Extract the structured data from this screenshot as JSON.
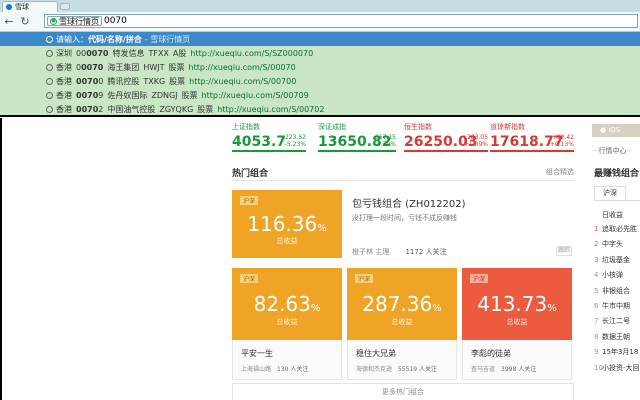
{
  "browser": {
    "tab_title": "雪球",
    "search_engine": "雪球行情页",
    "query": "0070",
    "colors": {
      "selected_row": "#3c88c9",
      "dropdown_bg": "#c9e7c4",
      "url_green": "#0a6b2b"
    }
  },
  "suggestions": {
    "hint_row": {
      "prefix": "请输入：",
      "main": "代码/名称/拼合",
      "hint": "- 雪球行情页"
    },
    "rows": [
      {
        "market": "深圳",
        "code_pre": "00",
        "code_hl": "0070",
        "code_post": "",
        "name": "特发信息",
        "abbr": "TFXX",
        "type": "A股",
        "url": "http://xueqiu.com/S/SZ000070"
      },
      {
        "market": "香港",
        "code_pre": "0",
        "code_hl": "0070",
        "code_post": "",
        "name": "海王集团",
        "abbr": "HWJT",
        "type": "股票",
        "url": "http://xueqiu.com/S/00070"
      },
      {
        "market": "香港",
        "code_pre": "",
        "code_hl": "0070",
        "code_post": "0",
        "name": "腾讯控股",
        "abbr": "TXKG",
        "type": "股票",
        "url": "http://xueqiu.com/S/00700"
      },
      {
        "market": "香港",
        "code_pre": "",
        "code_hl": "0070",
        "code_post": "9",
        "name": "佐丹奴国际",
        "abbr": "ZDNGJ",
        "type": "股票",
        "url": "http://xueqiu.com/S/00709"
      },
      {
        "market": "香港",
        "code_pre": "",
        "code_hl": "0070",
        "code_post": "2",
        "name": "中国油气控股",
        "abbr": "ZGYQKG",
        "type": "股票",
        "url": "http://xueqiu.com/S/00702"
      }
    ]
  },
  "indices": [
    {
      "name": "上证指数",
      "value": "4053.7",
      "change": "-223.52",
      "pct": "-5.23%",
      "dir": "down"
    },
    {
      "name": "深证成指",
      "value": "13650.82",
      "change": "-667.15",
      "pct": "-4.79%",
      "dir": "down"
    },
    {
      "name": "恒生指数",
      "value": "26250.03",
      "change": "+283.05",
      "pct": "+1.09%",
      "dir": "up"
    },
    {
      "name": "道琼斯指数",
      "value": "17618.77",
      "change": "+22.42",
      "pct": "+0.13%",
      "dir": "up"
    }
  ],
  "hot": {
    "title": "热门组合",
    "link": "组合精选",
    "featured": {
      "tag": "沪深",
      "percent": "116.36",
      "percent_unit": "%",
      "label": "总收益",
      "name": "包亏钱组合 (ZH012202)",
      "desc": "没打理一段时间，亏钱不成反赚钱",
      "author": "橙子林",
      "author_role": "主理",
      "followers": "1172 人关注",
      "action": "跟踪"
    },
    "cards": [
      {
        "tag": "沪深",
        "percent": "82.63",
        "unit": "%",
        "label": "总收益",
        "name": "平安一生",
        "author": "上海福山路",
        "followers": "130 人关注"
      },
      {
        "tag": "沪深",
        "percent": "287.36",
        "unit": "%",
        "label": "总收益",
        "name": "稳住大兄弟",
        "author": "海德和杰克逊",
        "followers": "55519 人关注"
      },
      {
        "tag": "沪深",
        "percent": "413.73",
        "unit": "%",
        "label": "总收益",
        "name": "李彪的徒弟",
        "author": "查马吉道",
        "followers": "3998 人关注"
      }
    ],
    "more": "更多热门组合"
  },
  "sidebar": {
    "ios_label": "iOS",
    "quote_center": "· 行情中心 ·",
    "title": "最赚钱组合",
    "tab": "沪深",
    "subtitle": "日收益",
    "items": [
      {
        "no": "1",
        "label": "追取必先胜"
      },
      {
        "no": "2",
        "label": "中字头"
      },
      {
        "no": "3",
        "label": "垃圾基金"
      },
      {
        "no": "4",
        "label": "小核弹"
      },
      {
        "no": "5",
        "label": "非银组合"
      },
      {
        "no": "6",
        "label": "牛市中期"
      },
      {
        "no": "7",
        "label": "长江二号"
      },
      {
        "no": "8",
        "label": "数据王朝"
      },
      {
        "no": "9",
        "label": "15年3月18"
      },
      {
        "no": "10",
        "label": "小投资-大回"
      }
    ]
  }
}
